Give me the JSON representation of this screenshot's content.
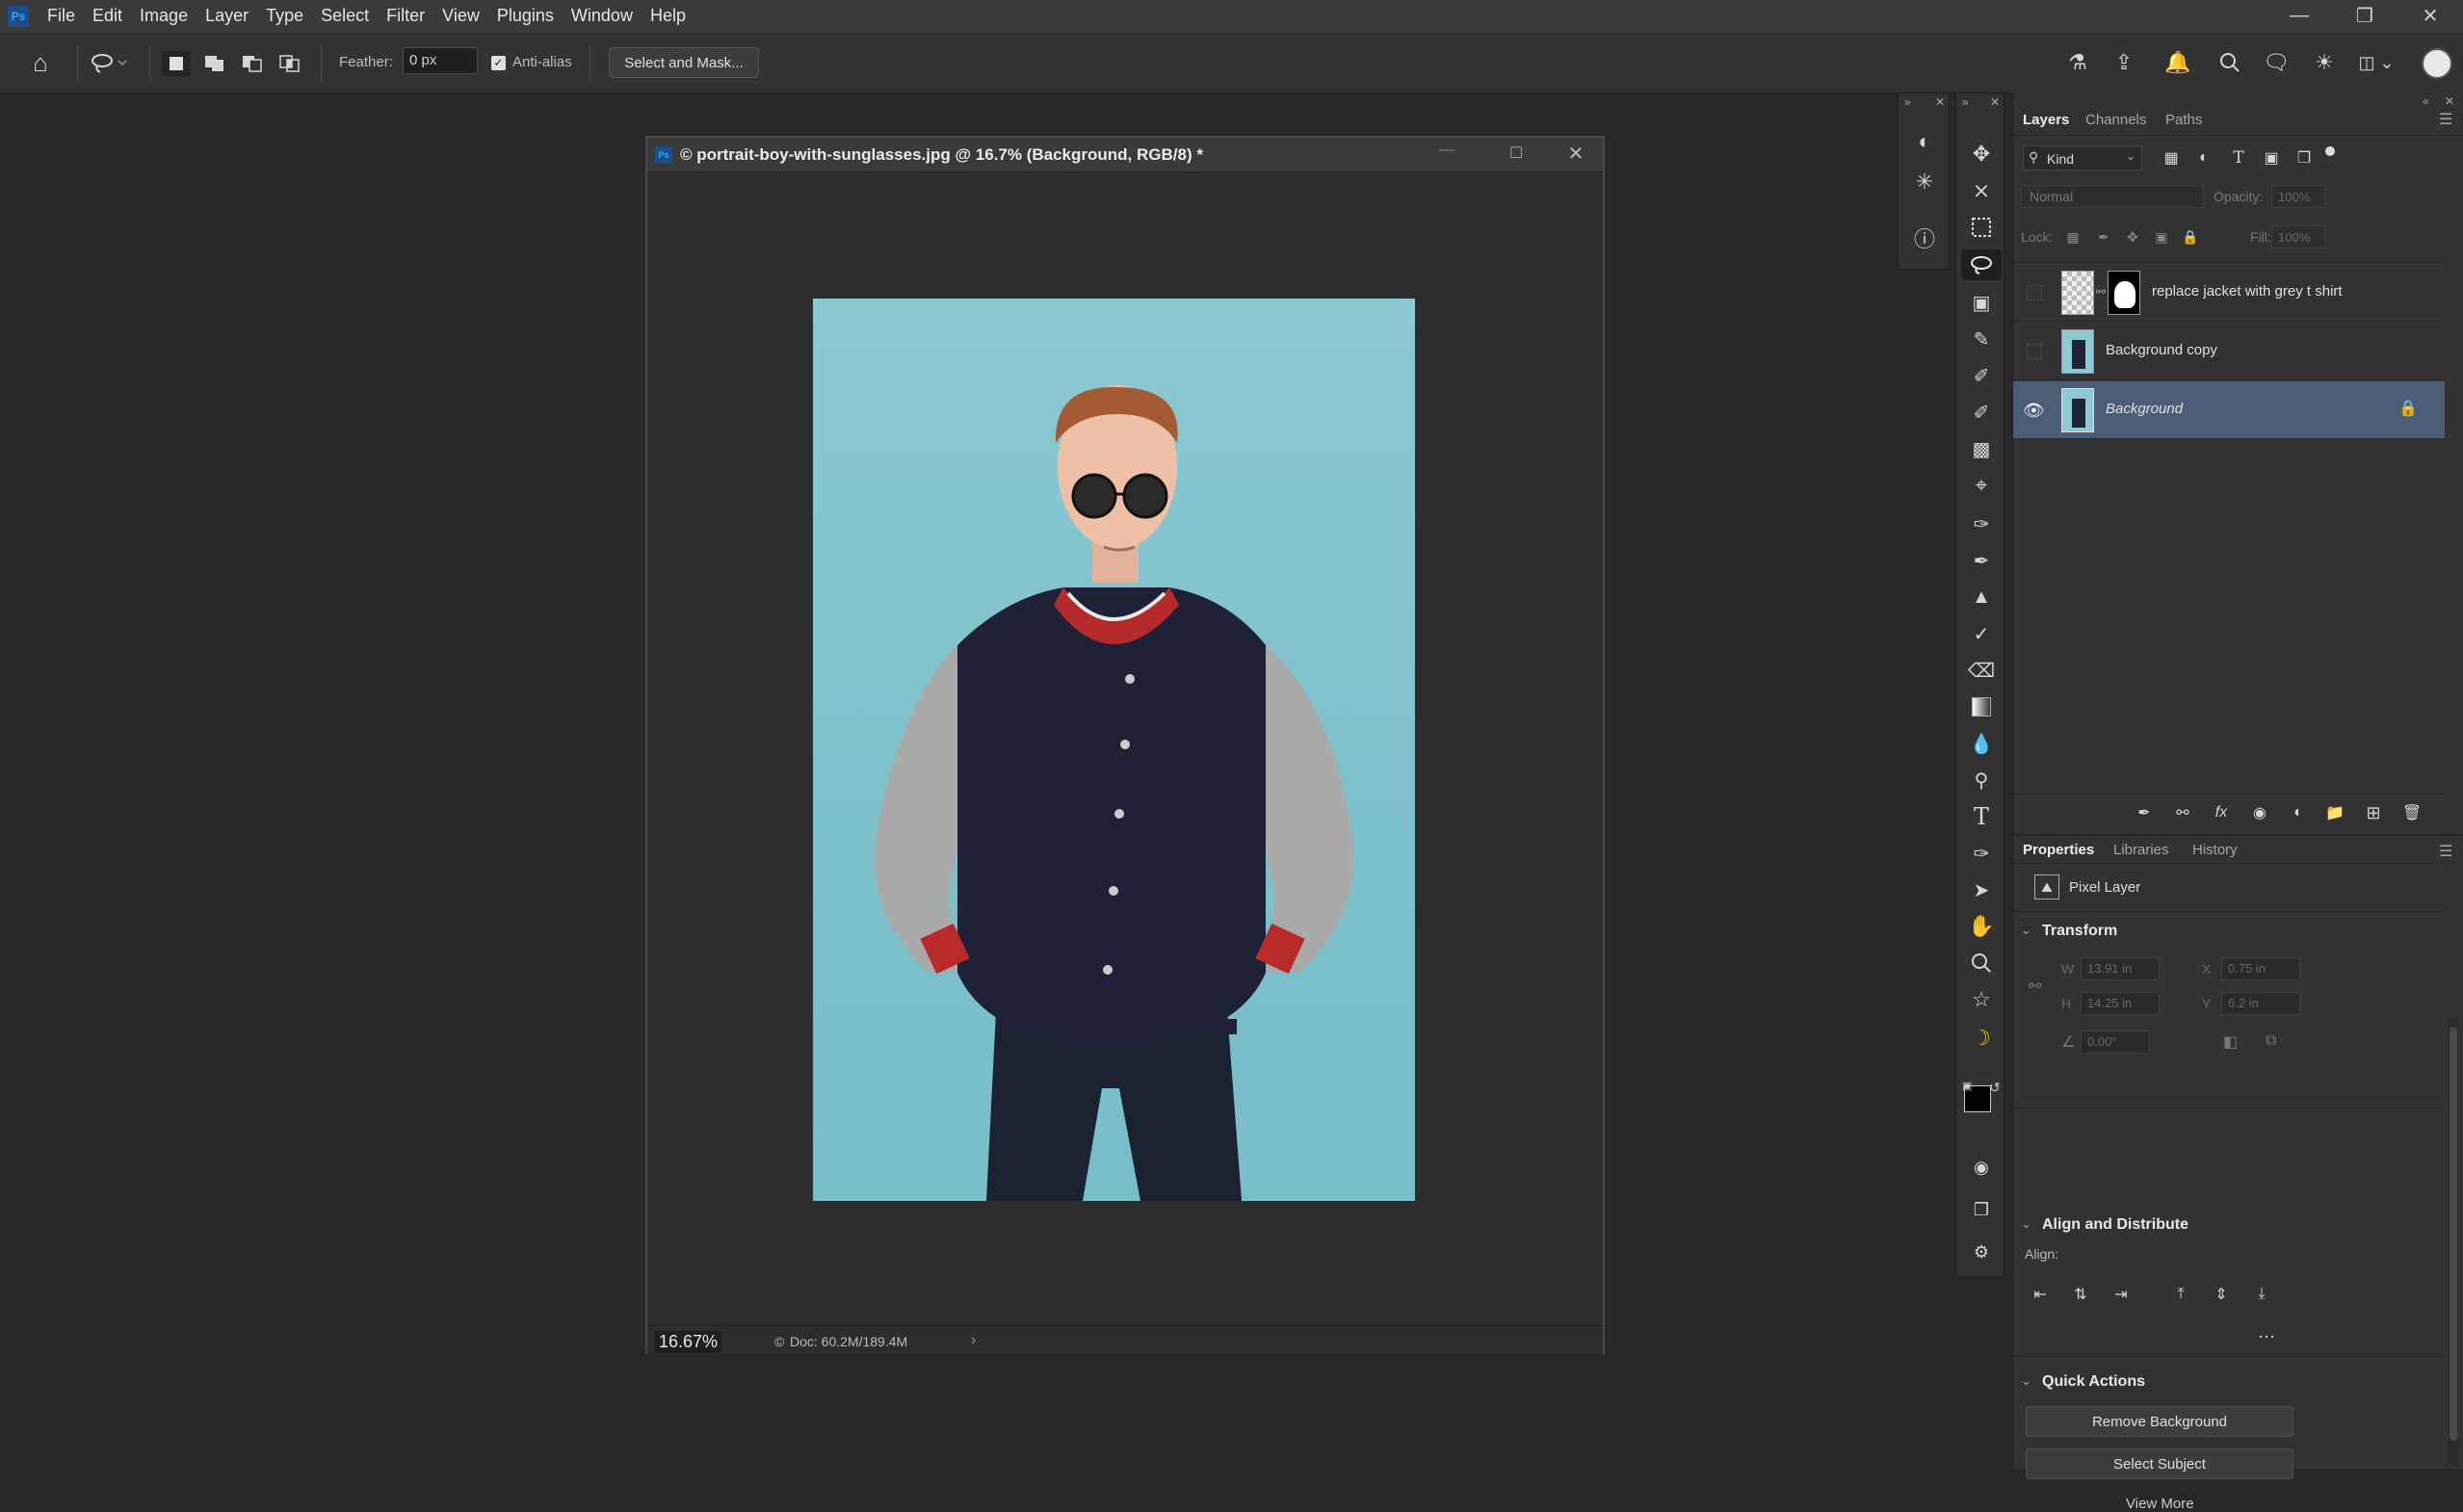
{
  "app": {
    "logo": "Ps"
  },
  "menu": [
    "File",
    "Edit",
    "Image",
    "Layer",
    "Type",
    "Select",
    "Filter",
    "View",
    "Plugins",
    "Window",
    "Help"
  ],
  "options": {
    "feather_label": "Feather:",
    "feather_value": "0 px",
    "antialias_label": "Anti-alias",
    "select_mask_label": "Select and Mask..."
  },
  "document": {
    "title": "© portrait-boy-with-sunglasses.jpg @ 16.7% (Background, RGB/8) *",
    "zoom": "16.67%",
    "doc_info": "Doc: 60.2M/189.4M"
  },
  "layers_panel": {
    "tabs": [
      "Layers",
      "Channels",
      "Paths"
    ],
    "kind_label": "Kind",
    "blend_mode": "Normal",
    "opacity_label": "Opacity:",
    "opacity_value": "100%",
    "lock_label": "Lock:",
    "fill_label": "Fill:",
    "fill_value": "100%",
    "layers": [
      {
        "name": "replace jacket with grey t shirt"
      },
      {
        "name": "Background copy"
      },
      {
        "name": "Background"
      }
    ]
  },
  "properties_panel": {
    "tabs": [
      "Properties",
      "Libraries",
      "History"
    ],
    "layer_type": "Pixel Layer",
    "transform": {
      "title": "Transform",
      "w_label": "W",
      "w_value": "13.91 in",
      "x_label": "X",
      "x_value": "0.75 in",
      "h_label": "H",
      "h_value": "14.25 in",
      "y_label": "Y",
      "y_value": "6.2 in",
      "angle_value": "0.00°"
    },
    "align": {
      "title": "Align and Distribute",
      "label": "Align:"
    },
    "quick_actions": {
      "title": "Quick Actions",
      "remove_bg": "Remove Background",
      "select_subject": "Select Subject",
      "view_more": "View More"
    }
  }
}
